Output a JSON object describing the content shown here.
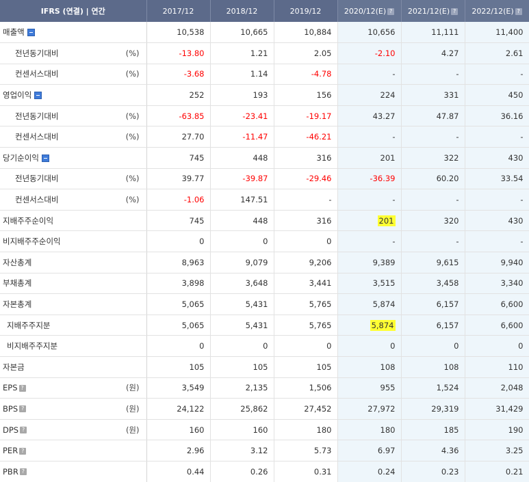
{
  "header": {
    "title": "IFRS (연결) | 연간",
    "columns": [
      {
        "label": "2017/12",
        "estimate": false
      },
      {
        "label": "2018/12",
        "estimate": false
      },
      {
        "label": "2019/12",
        "estimate": false
      },
      {
        "label": "2020/12(E)",
        "estimate": true
      },
      {
        "label": "2021/12(E)",
        "estimate": true
      },
      {
        "label": "2022/12(E)",
        "estimate": true
      }
    ]
  },
  "rows": [
    {
      "label": "매출액",
      "unit": "",
      "indent": 0,
      "toggle": true,
      "help": false,
      "values": [
        "10,538",
        "10,665",
        "10,884",
        "10,656",
        "11,111",
        "11,400"
      ]
    },
    {
      "label": "전년동기대비",
      "unit": "(%)",
      "indent": 1,
      "toggle": false,
      "help": false,
      "values": [
        "-13.80",
        "1.21",
        "2.05",
        "-2.10",
        "4.27",
        "2.61"
      ]
    },
    {
      "label": "컨센서스대비",
      "unit": "(%)",
      "indent": 1,
      "toggle": false,
      "help": false,
      "values": [
        "-3.68",
        "1.14",
        "-4.78",
        "-",
        "-",
        "-"
      ]
    },
    {
      "label": "영업이익",
      "unit": "",
      "indent": 0,
      "toggle": true,
      "help": false,
      "values": [
        "252",
        "193",
        "156",
        "224",
        "331",
        "450"
      ]
    },
    {
      "label": "전년동기대비",
      "unit": "(%)",
      "indent": 1,
      "toggle": false,
      "help": false,
      "values": [
        "-63.85",
        "-23.41",
        "-19.17",
        "43.27",
        "47.87",
        "36.16"
      ]
    },
    {
      "label": "컨센서스대비",
      "unit": "(%)",
      "indent": 1,
      "toggle": false,
      "help": false,
      "values": [
        "27.70",
        "-11.47",
        "-46.21",
        "-",
        "-",
        "-"
      ]
    },
    {
      "label": "당기순이익",
      "unit": "",
      "indent": 0,
      "toggle": true,
      "help": false,
      "values": [
        "745",
        "448",
        "316",
        "201",
        "322",
        "430"
      ]
    },
    {
      "label": "전년동기대비",
      "unit": "(%)",
      "indent": 1,
      "toggle": false,
      "help": false,
      "values": [
        "39.77",
        "-39.87",
        "-29.46",
        "-36.39",
        "60.20",
        "33.54"
      ]
    },
    {
      "label": "컨센서스대비",
      "unit": "(%)",
      "indent": 1,
      "toggle": false,
      "help": false,
      "values": [
        "-1.06",
        "147.51",
        "-",
        "-",
        "-",
        "-"
      ]
    },
    {
      "label": "지배주주순이익",
      "unit": "",
      "indent": 0,
      "toggle": false,
      "help": false,
      "values": [
        "745",
        "448",
        "316",
        "201",
        "320",
        "430"
      ],
      "highlight": [
        3
      ]
    },
    {
      "label": "비지배주주순이익",
      "unit": "",
      "indent": 0,
      "toggle": false,
      "help": false,
      "values": [
        "0",
        "0",
        "0",
        "-",
        "-",
        "-"
      ]
    },
    {
      "label": "자산총계",
      "unit": "",
      "indent": 0,
      "toggle": false,
      "help": false,
      "values": [
        "8,963",
        "9,079",
        "9,206",
        "9,389",
        "9,615",
        "9,940"
      ]
    },
    {
      "label": "부채총계",
      "unit": "",
      "indent": 0,
      "toggle": false,
      "help": false,
      "values": [
        "3,898",
        "3,648",
        "3,441",
        "3,515",
        "3,458",
        "3,340"
      ]
    },
    {
      "label": "자본총계",
      "unit": "",
      "indent": 0,
      "toggle": false,
      "help": false,
      "values": [
        "5,065",
        "5,431",
        "5,765",
        "5,874",
        "6,157",
        "6,600"
      ]
    },
    {
      "label": "지배주주지분",
      "unit": "",
      "indent": 2,
      "toggle": false,
      "help": false,
      "values": [
        "5,065",
        "5,431",
        "5,765",
        "5,874",
        "6,157",
        "6,600"
      ],
      "highlight": [
        3
      ]
    },
    {
      "label": "비지배주주지분",
      "unit": "",
      "indent": 2,
      "toggle": false,
      "help": false,
      "values": [
        "0",
        "0",
        "0",
        "0",
        "0",
        "0"
      ]
    },
    {
      "label": "자본금",
      "unit": "",
      "indent": 0,
      "toggle": false,
      "help": false,
      "values": [
        "105",
        "105",
        "105",
        "108",
        "108",
        "110"
      ]
    },
    {
      "label": "EPS",
      "unit": "(원)",
      "indent": 0,
      "toggle": false,
      "help": true,
      "values": [
        "3,549",
        "2,135",
        "1,506",
        "955",
        "1,524",
        "2,048"
      ]
    },
    {
      "label": "BPS",
      "unit": "(원)",
      "indent": 0,
      "toggle": false,
      "help": true,
      "values": [
        "24,122",
        "25,862",
        "27,452",
        "27,972",
        "29,319",
        "31,429"
      ]
    },
    {
      "label": "DPS",
      "unit": "(원)",
      "indent": 0,
      "toggle": false,
      "help": true,
      "values": [
        "160",
        "160",
        "180",
        "180",
        "185",
        "190"
      ]
    },
    {
      "label": "PER",
      "unit": "",
      "indent": 0,
      "toggle": false,
      "help": true,
      "values": [
        "2.96",
        "3.12",
        "5.73",
        "6.97",
        "4.36",
        "3.25"
      ]
    },
    {
      "label": "PBR",
      "unit": "",
      "indent": 0,
      "toggle": false,
      "help": true,
      "values": [
        "0.44",
        "0.26",
        "0.31",
        "0.24",
        "0.23",
        "0.21"
      ]
    }
  ],
  "colors": {
    "header_bg": "#5c6a8a",
    "estimate_bg": "#eef6fb",
    "negative": "#ff0000",
    "highlight": "#ffff33",
    "toggle": "#3f7bd9"
  },
  "icons": {
    "toggle": "collapse-minus-icon",
    "help": "help-question-icon"
  }
}
